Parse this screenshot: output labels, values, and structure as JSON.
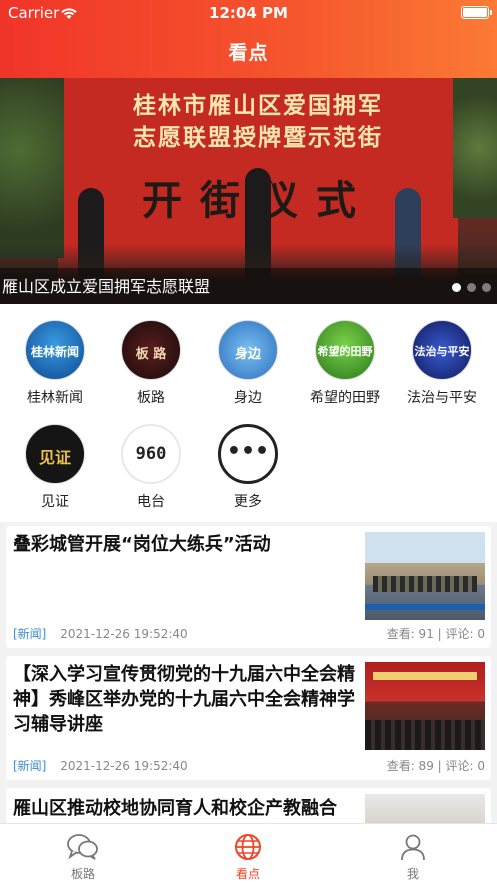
{
  "status_bar": {
    "carrier": "Carrier",
    "time": "12:04 PM"
  },
  "header": {
    "title": "看点"
  },
  "banner": {
    "board_line1": "桂林市雁山区爱国拥军",
    "board_line2": "志愿联盟授牌暨示范街",
    "board_line3": "开街仪式",
    "caption": "雁山区成立爱国拥军志愿联盟",
    "page_count": 3,
    "active_index": 0
  },
  "channels": [
    {
      "label": "桂林新闻",
      "icon_text": "桂林新闻",
      "color": "#1a6fc4"
    },
    {
      "label": "板路",
      "icon_text": "板 路",
      "color": "#3a1a1a"
    },
    {
      "label": "身边",
      "icon_text": "身边",
      "color": "#3a84d6"
    },
    {
      "label": "希望的田野",
      "icon_text": "希望的田野",
      "color": "#3ea82c"
    },
    {
      "label": "法治与平安",
      "icon_text": "法治与平安",
      "color": "#2a3f9e"
    },
    {
      "label": "见证",
      "icon_text": "见证",
      "color": "#1a1a1a"
    },
    {
      "label": "电台",
      "icon_text": "960",
      "color": "#ffffff"
    },
    {
      "label": "更多",
      "icon_text": "•••",
      "color": "#ffffff"
    }
  ],
  "news": [
    {
      "title": "叠彩城管开展“岗位大练兵”活动",
      "tag": "[新闻]",
      "time": "2021-12-26 19:52:40",
      "stats": "查看: 91 | 评论: 0"
    },
    {
      "title": "【深入学习宣传贯彻党的十九届六中全会精神】秀峰区举办党的十九届六中全会精神学习辅导讲座",
      "tag": "[新闻]",
      "time": "2021-12-26 19:52:40",
      "stats": "查看: 89 | 评论: 0"
    },
    {
      "title": "雁山区推动校地协同育人和校企产教融合"
    }
  ],
  "tabbar": {
    "tabs": [
      {
        "label": "板路"
      },
      {
        "label": "看点"
      },
      {
        "label": "我"
      }
    ],
    "active": "看点"
  },
  "colors": {
    "accent": "#f0462a",
    "tag": "#3a8dd8"
  }
}
